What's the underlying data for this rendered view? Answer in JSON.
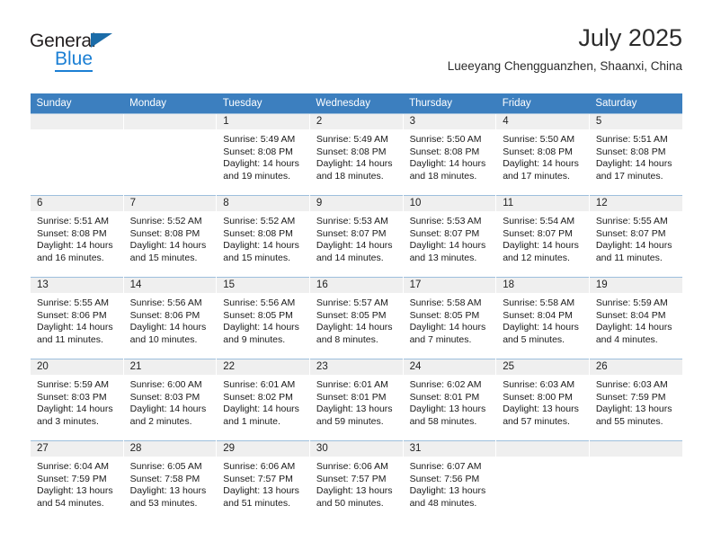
{
  "brand": {
    "name_top": "General",
    "name_bottom": "Blue",
    "flag_icon": "triangle-flag-icon",
    "accent_color": "#1b7fd4"
  },
  "header": {
    "title": "July 2025",
    "subtitle": "Lueeyang Chengguanzhen, Shaanxi, China"
  },
  "calendar": {
    "header_color": "#3c7fbf",
    "daynum_band_color": "#efefef",
    "weekdays": [
      "Sunday",
      "Monday",
      "Tuesday",
      "Wednesday",
      "Thursday",
      "Friday",
      "Saturday"
    ],
    "weeks": [
      [
        {
          "day": "",
          "lines": []
        },
        {
          "day": "",
          "lines": []
        },
        {
          "day": "1",
          "lines": [
            "Sunrise: 5:49 AM",
            "Sunset: 8:08 PM",
            "Daylight: 14 hours",
            "and 19 minutes."
          ]
        },
        {
          "day": "2",
          "lines": [
            "Sunrise: 5:49 AM",
            "Sunset: 8:08 PM",
            "Daylight: 14 hours",
            "and 18 minutes."
          ]
        },
        {
          "day": "3",
          "lines": [
            "Sunrise: 5:50 AM",
            "Sunset: 8:08 PM",
            "Daylight: 14 hours",
            "and 18 minutes."
          ]
        },
        {
          "day": "4",
          "lines": [
            "Sunrise: 5:50 AM",
            "Sunset: 8:08 PM",
            "Daylight: 14 hours",
            "and 17 minutes."
          ]
        },
        {
          "day": "5",
          "lines": [
            "Sunrise: 5:51 AM",
            "Sunset: 8:08 PM",
            "Daylight: 14 hours",
            "and 17 minutes."
          ]
        }
      ],
      [
        {
          "day": "6",
          "lines": [
            "Sunrise: 5:51 AM",
            "Sunset: 8:08 PM",
            "Daylight: 14 hours",
            "and 16 minutes."
          ]
        },
        {
          "day": "7",
          "lines": [
            "Sunrise: 5:52 AM",
            "Sunset: 8:08 PM",
            "Daylight: 14 hours",
            "and 15 minutes."
          ]
        },
        {
          "day": "8",
          "lines": [
            "Sunrise: 5:52 AM",
            "Sunset: 8:08 PM",
            "Daylight: 14 hours",
            "and 15 minutes."
          ]
        },
        {
          "day": "9",
          "lines": [
            "Sunrise: 5:53 AM",
            "Sunset: 8:07 PM",
            "Daylight: 14 hours",
            "and 14 minutes."
          ]
        },
        {
          "day": "10",
          "lines": [
            "Sunrise: 5:53 AM",
            "Sunset: 8:07 PM",
            "Daylight: 14 hours",
            "and 13 minutes."
          ]
        },
        {
          "day": "11",
          "lines": [
            "Sunrise: 5:54 AM",
            "Sunset: 8:07 PM",
            "Daylight: 14 hours",
            "and 12 minutes."
          ]
        },
        {
          "day": "12",
          "lines": [
            "Sunrise: 5:55 AM",
            "Sunset: 8:07 PM",
            "Daylight: 14 hours",
            "and 11 minutes."
          ]
        }
      ],
      [
        {
          "day": "13",
          "lines": [
            "Sunrise: 5:55 AM",
            "Sunset: 8:06 PM",
            "Daylight: 14 hours",
            "and 11 minutes."
          ]
        },
        {
          "day": "14",
          "lines": [
            "Sunrise: 5:56 AM",
            "Sunset: 8:06 PM",
            "Daylight: 14 hours",
            "and 10 minutes."
          ]
        },
        {
          "day": "15",
          "lines": [
            "Sunrise: 5:56 AM",
            "Sunset: 8:05 PM",
            "Daylight: 14 hours",
            "and 9 minutes."
          ]
        },
        {
          "day": "16",
          "lines": [
            "Sunrise: 5:57 AM",
            "Sunset: 8:05 PM",
            "Daylight: 14 hours",
            "and 8 minutes."
          ]
        },
        {
          "day": "17",
          "lines": [
            "Sunrise: 5:58 AM",
            "Sunset: 8:05 PM",
            "Daylight: 14 hours",
            "and 7 minutes."
          ]
        },
        {
          "day": "18",
          "lines": [
            "Sunrise: 5:58 AM",
            "Sunset: 8:04 PM",
            "Daylight: 14 hours",
            "and 5 minutes."
          ]
        },
        {
          "day": "19",
          "lines": [
            "Sunrise: 5:59 AM",
            "Sunset: 8:04 PM",
            "Daylight: 14 hours",
            "and 4 minutes."
          ]
        }
      ],
      [
        {
          "day": "20",
          "lines": [
            "Sunrise: 5:59 AM",
            "Sunset: 8:03 PM",
            "Daylight: 14 hours",
            "and 3 minutes."
          ]
        },
        {
          "day": "21",
          "lines": [
            "Sunrise: 6:00 AM",
            "Sunset: 8:03 PM",
            "Daylight: 14 hours",
            "and 2 minutes."
          ]
        },
        {
          "day": "22",
          "lines": [
            "Sunrise: 6:01 AM",
            "Sunset: 8:02 PM",
            "Daylight: 14 hours",
            "and 1 minute."
          ]
        },
        {
          "day": "23",
          "lines": [
            "Sunrise: 6:01 AM",
            "Sunset: 8:01 PM",
            "Daylight: 13 hours",
            "and 59 minutes."
          ]
        },
        {
          "day": "24",
          "lines": [
            "Sunrise: 6:02 AM",
            "Sunset: 8:01 PM",
            "Daylight: 13 hours",
            "and 58 minutes."
          ]
        },
        {
          "day": "25",
          "lines": [
            "Sunrise: 6:03 AM",
            "Sunset: 8:00 PM",
            "Daylight: 13 hours",
            "and 57 minutes."
          ]
        },
        {
          "day": "26",
          "lines": [
            "Sunrise: 6:03 AM",
            "Sunset: 7:59 PM",
            "Daylight: 13 hours",
            "and 55 minutes."
          ]
        }
      ],
      [
        {
          "day": "27",
          "lines": [
            "Sunrise: 6:04 AM",
            "Sunset: 7:59 PM",
            "Daylight: 13 hours",
            "and 54 minutes."
          ]
        },
        {
          "day": "28",
          "lines": [
            "Sunrise: 6:05 AM",
            "Sunset: 7:58 PM",
            "Daylight: 13 hours",
            "and 53 minutes."
          ]
        },
        {
          "day": "29",
          "lines": [
            "Sunrise: 6:06 AM",
            "Sunset: 7:57 PM",
            "Daylight: 13 hours",
            "and 51 minutes."
          ]
        },
        {
          "day": "30",
          "lines": [
            "Sunrise: 6:06 AM",
            "Sunset: 7:57 PM",
            "Daylight: 13 hours",
            "and 50 minutes."
          ]
        },
        {
          "day": "31",
          "lines": [
            "Sunrise: 6:07 AM",
            "Sunset: 7:56 PM",
            "Daylight: 13 hours",
            "and 48 minutes."
          ]
        },
        {
          "day": "",
          "lines": []
        },
        {
          "day": "",
          "lines": []
        }
      ]
    ]
  }
}
